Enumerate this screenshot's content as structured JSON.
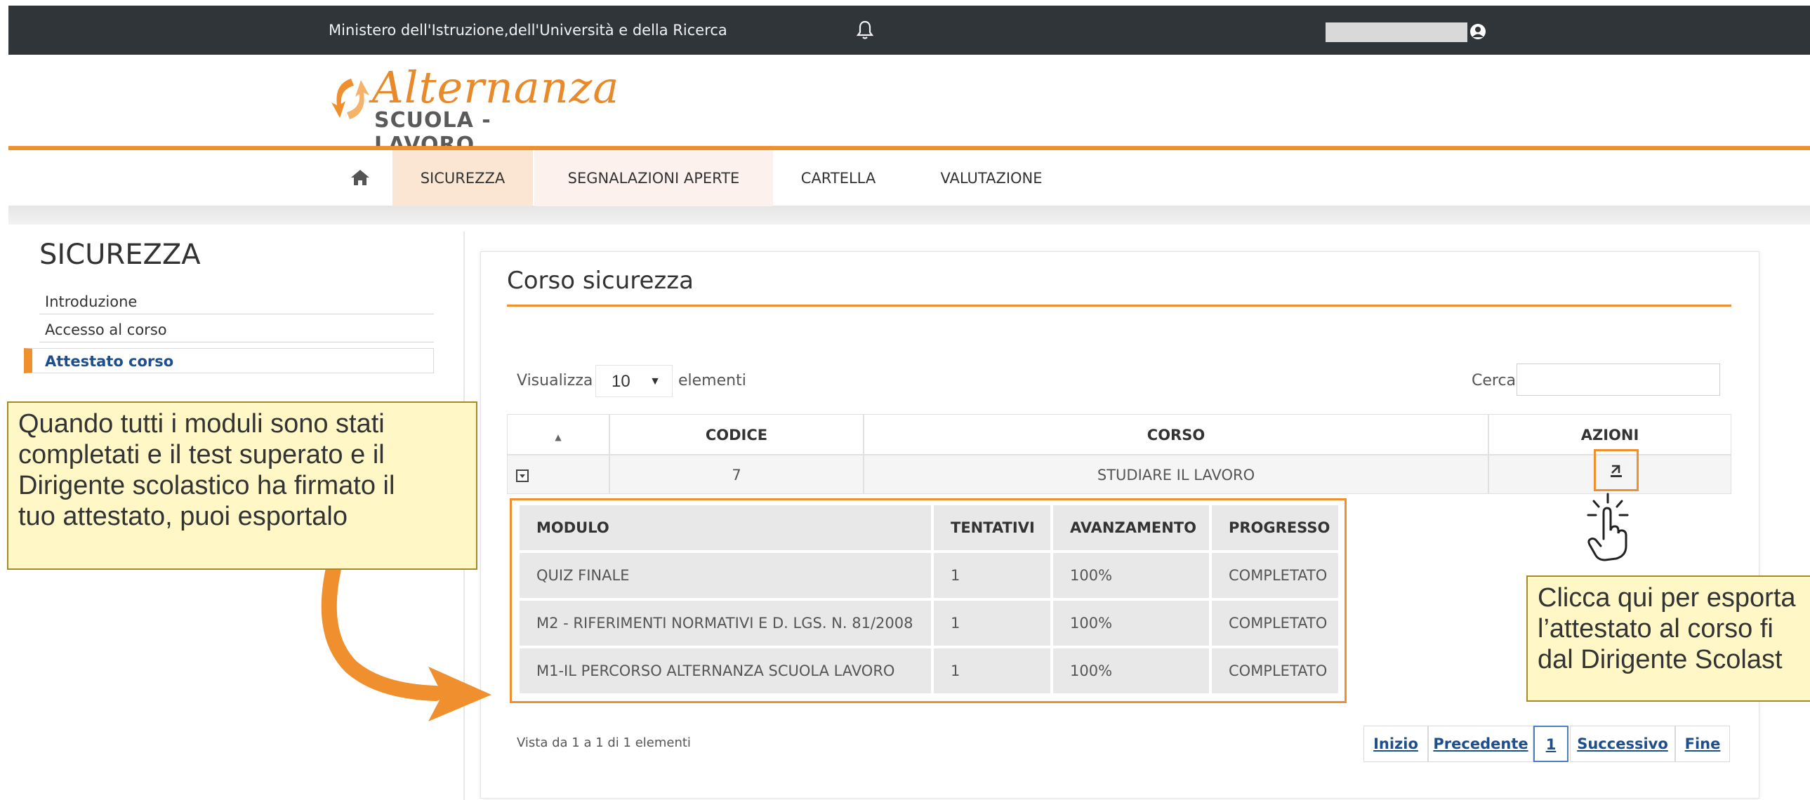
{
  "topbar": {
    "ministry": "Ministero dell'Istruzione,dell'Università e della Ricerca"
  },
  "logo": {
    "script": "Alternanza",
    "sub": "SCUOLA - LAVORO"
  },
  "nav": {
    "tabs": [
      "SICUREZZA",
      "SEGNALAZIONI APERTE",
      "CARTELLA",
      "VALUTAZIONE"
    ]
  },
  "sidebar": {
    "title": "SICUREZZA",
    "items": [
      "Introduzione",
      "Accesso al corso",
      "Attestato corso"
    ]
  },
  "main": {
    "title": "Corso sicurezza",
    "show_label": "Visualizza",
    "show_value": "10",
    "show_suffix": "elementi",
    "search_label": "Cerca:",
    "search_value": "",
    "columns": [
      "",
      "CODICE",
      "CORSO",
      "AZIONI"
    ],
    "row": {
      "codice": "7",
      "corso": "STUDIARE IL LAVORO"
    },
    "inner": {
      "headers": [
        "MODULO",
        "TENTATIVI",
        "AVANZAMENTO",
        "PROGRESSO"
      ],
      "rows": [
        [
          "QUIZ FINALE",
          "1",
          "100%",
          "COMPLETATO"
        ],
        [
          "M2 - RIFERIMENTI NORMATIVI E D. LGS. N. 81/2008",
          "1",
          "100%",
          "COMPLETATO"
        ],
        [
          "M1-IL PERCORSO ALTERNANZA SCUOLA LAVORO",
          "1",
          "100%",
          "COMPLETATO"
        ]
      ]
    },
    "footer": "Vista da 1 a 1 di 1 elementi",
    "pager": [
      "Inizio",
      "Precedente",
      "1",
      "Successivo",
      "Fine"
    ]
  },
  "callouts": {
    "left": [
      "Quando tutti i moduli sono stati",
      "completati e il test superato e il",
      "Dirigente scolastico ha firmato il",
      "tuo attestato, puoi esportalo"
    ],
    "right": [
      "Clicca qui per esporta",
      "l’attestato al corso fi",
      "dal Dirigente Scolast"
    ]
  },
  "colors": {
    "accent": "#ef8f2e",
    "topbar": "#303539",
    "link": "#1f4e8c",
    "callout_bg": "#fff8c6"
  },
  "icons": [
    "bell-icon",
    "user-icon",
    "home-icon",
    "sort-icon",
    "expand-icon",
    "export-icon",
    "hand-pointer-icon",
    "curved-arrow-icon"
  ]
}
